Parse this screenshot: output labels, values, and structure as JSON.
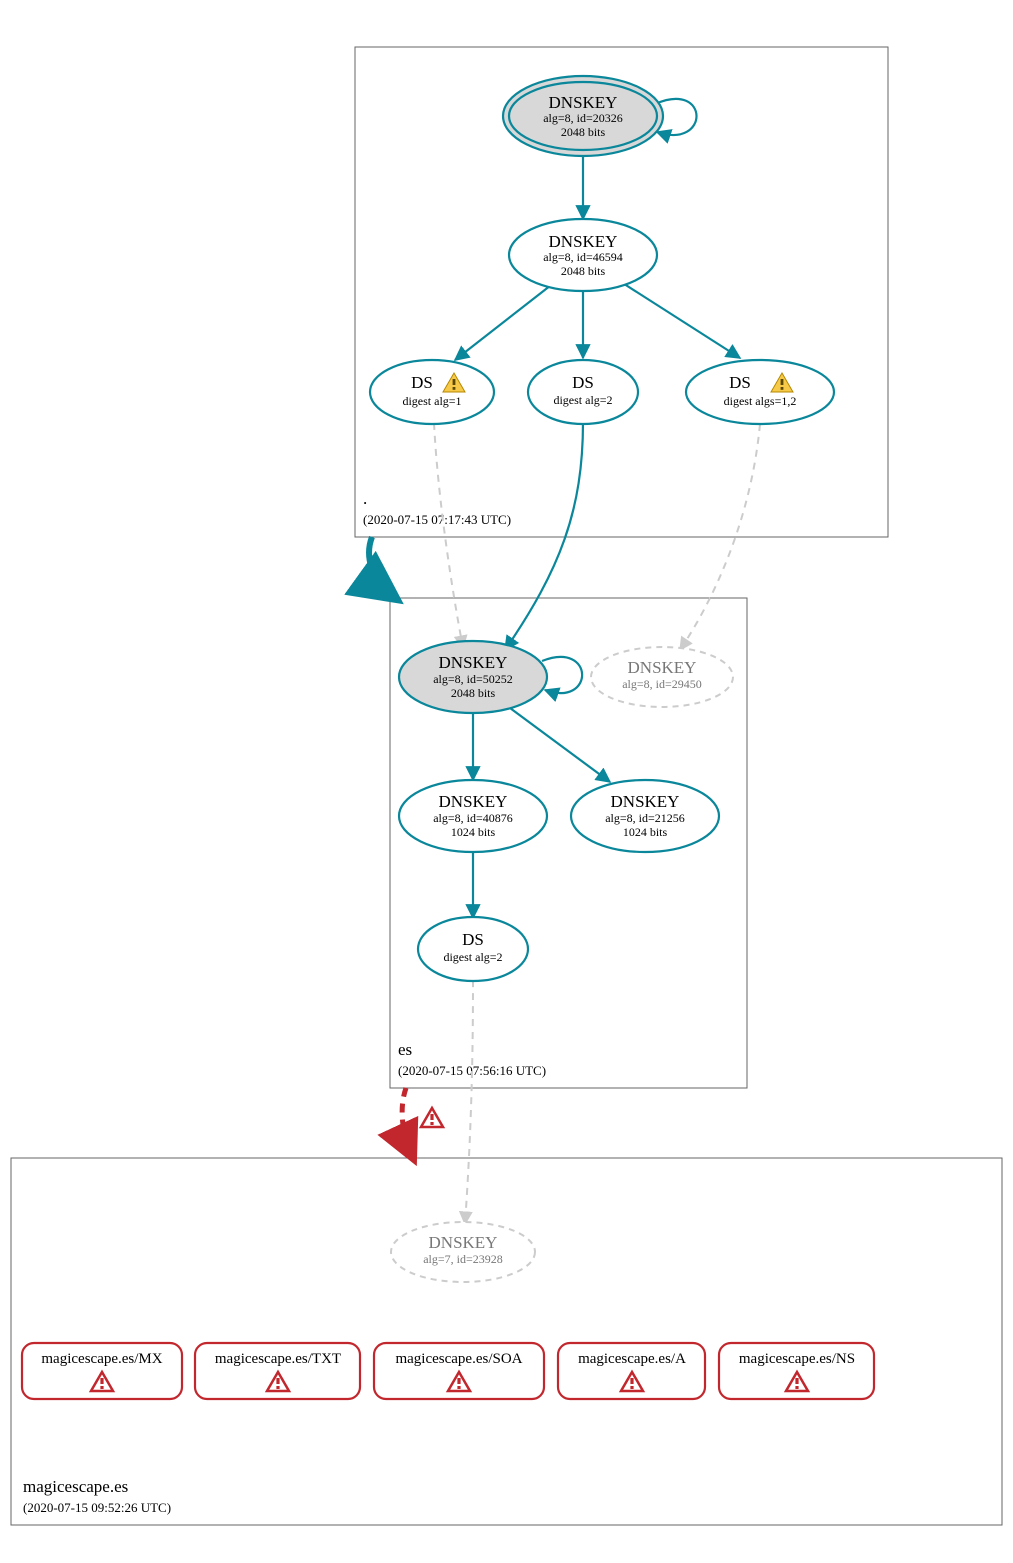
{
  "zones": {
    "root": {
      "label": ".",
      "timestamp": "(2020-07-15 07:17:43 UTC)"
    },
    "es": {
      "label": "es",
      "timestamp": "(2020-07-15 07:56:16 UTC)"
    },
    "leaf": {
      "label": "magicescape.es",
      "timestamp": "(2020-07-15 09:52:26 UTC)"
    }
  },
  "nodes": {
    "root_ksk": {
      "title": "DNSKEY",
      "line2": "alg=8, id=20326",
      "line3": "2048 bits"
    },
    "root_zsk": {
      "title": "DNSKEY",
      "line2": "alg=8, id=46594",
      "line3": "2048 bits"
    },
    "ds1": {
      "title": "DS",
      "line2": "digest alg=1"
    },
    "ds2": {
      "title": "DS",
      "line2": "digest alg=2"
    },
    "ds3": {
      "title": "DS",
      "line2": "digest algs=1,2"
    },
    "es_ksk": {
      "title": "DNSKEY",
      "line2": "alg=8, id=50252",
      "line3": "2048 bits"
    },
    "es_ghost": {
      "title": "DNSKEY",
      "line2": "alg=8, id=29450"
    },
    "es_zsk1": {
      "title": "DNSKEY",
      "line2": "alg=8, id=40876",
      "line3": "1024 bits"
    },
    "es_zsk2": {
      "title": "DNSKEY",
      "line2": "alg=8, id=21256",
      "line3": "1024 bits"
    },
    "es_ds": {
      "title": "DS",
      "line2": "digest alg=2"
    },
    "leaf_key": {
      "title": "DNSKEY",
      "line2": "alg=7, id=23928"
    }
  },
  "rrsets": {
    "mx": "magicescape.es/MX",
    "txt": "magicescape.es/TXT",
    "soa": "magicescape.es/SOA",
    "a": "magicescape.es/A",
    "ns": "magicescape.es/NS"
  },
  "colors": {
    "teal": "#0a879a",
    "red": "#c1272d",
    "grey": "#cccccc",
    "box": "#666666",
    "ksk_fill": "#d8d8d8"
  }
}
